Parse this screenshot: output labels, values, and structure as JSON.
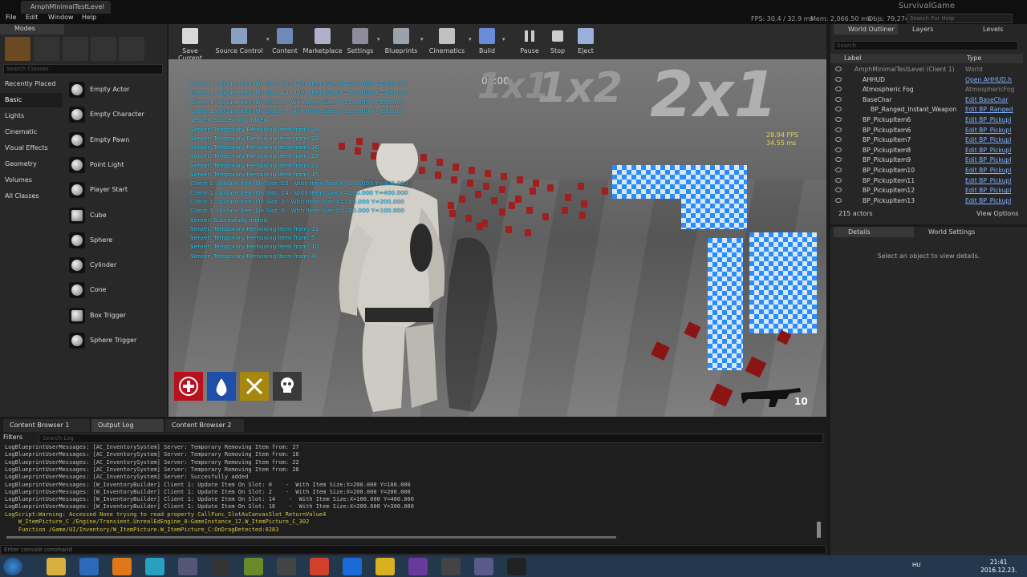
{
  "window": {
    "tab_title": "AmphMinimalTestLevel",
    "project": "SurvivalGame"
  },
  "menu": [
    "File",
    "Edit",
    "Window",
    "Help"
  ],
  "stats": {
    "fps": "FPS: 30.4 / 32.9 ms",
    "mem": "Mem: 2,066.50 mb",
    "objs": "Objs: 79,274",
    "help_placeholder": "Search For Help"
  },
  "modes": {
    "title": "Modes",
    "search_placeholder": "Search Classes",
    "categories": [
      "Recently Placed",
      "Basic",
      "Lights",
      "Cinematic",
      "Visual Effects",
      "Geometry",
      "Volumes",
      "All Classes"
    ],
    "classes": [
      "Empty Actor",
      "Empty Character",
      "Empty Pawn",
      "Point Light",
      "Player Start",
      "Cube",
      "Sphere",
      "Cylinder",
      "Cone",
      "Box Trigger",
      "Sphere Trigger"
    ]
  },
  "toolbar": {
    "buttons": [
      "Save Current",
      "Source Control",
      "Content",
      "Marketplace",
      "Settings",
      "Blueprints",
      "Cinematics",
      "Build",
      "Pause",
      "Stop",
      "Eject"
    ]
  },
  "viewport": {
    "messages": [
      "Client 1: Update Item On Slot: 16  -  With Item Size:X=200.000 Y=300.000",
      "Client 1: Update Item On Slot: 14  -  With Item Size:X=100.000 Y=400.000",
      "Client 1: Update Item On Slot: 2  -  With Item Size:X=200.000 Y=200.000",
      "Client 1: Update Item On Slot: 0  -  With Item Size:X=200.000 Y=100.000",
      "Server: Succesfully added",
      "Server: Temporary Removing Item from: 28",
      "Server: Temporary Removing Item from: 22",
      "Server: Temporary Removing Item from: 16",
      "Server: Temporary Removing Item from: 27",
      "Server: Temporary Removing Item from: 21",
      "Server: Temporary Removing Item from: 15",
      "Client 1: Update Item On Slot: 15  -  With Item Size:X=200.000 Y=300.000",
      "Client 1: Update Item On Slot: 14  -  With Item Size:X=100.000 Y=400.000",
      "Client 1: Update Item On Slot: 2  -  With Item Size:X=200.000 Y=200.000",
      "Client 1: Update Item On Slot: 0  -  With Item Size:X=200.000 Y=100.000",
      "Server: Succesfully added",
      "Server: Temporary Removing Item from: 11",
      "Server: Temporary Removing Item from: 5",
      "Server: Temporary Removing Item from: 10",
      "Server: Temporary Removing Item from: 4"
    ],
    "timer": "00:00",
    "sign1": "1x1",
    "sign2": "1x2",
    "sign3": "2x1",
    "fps": "28.94 FPS",
    "ms": "34.55 ms",
    "ammo": "10",
    "hotbar_icons": [
      "health-icon",
      "water-drop-icon",
      "food-icon",
      "skull-icon"
    ]
  },
  "bottom_tabs": [
    "Content Browser 1",
    "Output Log",
    "Content Browser 2"
  ],
  "log": {
    "filters": "Filters",
    "search_placeholder": "Search Log",
    "lines": [
      "LogBlueprintUserMessages: [AC_InventorySystem] Server: Temporary Removing Item from: 27",
      "LogBlueprintUserMessages: [AC_InventorySystem] Server: Temporary Removing Item from: 16",
      "LogBlueprintUserMessages: [AC_InventorySystem] Server: Temporary Removing Item from: 22",
      "LogBlueprintUserMessages: [AC_InventorySystem] Server: Temporary Removing Item from: 28",
      "LogBlueprintUserMessages: [AC_InventorySystem] Server: Succesfully added",
      "LogBlueprintUserMessages: [W_InventoryBuilder] Client 1: Update Item On Slot: 0    -  With Item Size:X=200.000 Y=100.000",
      "LogBlueprintUserMessages: [W_InventoryBuilder] Client 1: Update Item On Slot: 2    -  With Item Size:X=200.000 Y=200.000",
      "LogBlueprintUserMessages: [W_InventoryBuilder] Client 1: Update Item On Slot: 14    -  With Item Size:X=100.000 Y=400.000",
      "LogBlueprintUserMessages: [W_InventoryBuilder] Client 1: Update Item On Slot: 16    -  With Item Size:X=200.000 Y=300.000"
    ],
    "warn_lines": [
      "LogScript:Warning: Accessed None trying to read property CallFunc_SlotAsCanvasSlot_ReturnValue4",
      "    W_ItemPicture_C /Engine/Transient.UnrealEdEngine_0:GameInstance_17.W_ItemPicture_C_302",
      "    Function /Game/UI/Inventory/W_ItemPicture.W_ItemPicture_C:OnDragDetected:0283"
    ],
    "console_placeholder": "Enter console command"
  },
  "outliner": {
    "tabs": [
      "World Outliner",
      "Layers",
      "Levels"
    ],
    "search_placeholder": "Search",
    "col_label": "Label",
    "col_type": "Type",
    "rows": [
      {
        "name": "AmphMinimalTestLevel (Client 1)",
        "type": "World",
        "indent": 0,
        "link": false
      },
      {
        "name": "AHHUD",
        "type": "Open AHHUD.h",
        "indent": 1,
        "link": true
      },
      {
        "name": "Atmospheric Fog",
        "type": "AtmosphericFog",
        "indent": 1,
        "link": false
      },
      {
        "name": "BaseChar",
        "type": "Edit BaseChar",
        "indent": 1,
        "link": true
      },
      {
        "name": "BP_Ranged_Instant_Weapon",
        "type": "Edit BP_Ranged",
        "indent": 2,
        "link": true
      },
      {
        "name": "BP_PickupItem6",
        "type": "Edit BP_Pickupl",
        "indent": 1,
        "link": true
      },
      {
        "name": "BP_PickupItem6",
        "type": "Edit BP_Pickupl",
        "indent": 1,
        "link": true
      },
      {
        "name": "BP_PickupItem7",
        "type": "Edit BP_Pickupl",
        "indent": 1,
        "link": true
      },
      {
        "name": "BP_PickupItem8",
        "type": "Edit BP_Pickupl",
        "indent": 1,
        "link": true
      },
      {
        "name": "BP_PickupItem9",
        "type": "Edit BP_Pickupl",
        "indent": 1,
        "link": true
      },
      {
        "name": "BP_PickupItem10",
        "type": "Edit BP_Pickupl",
        "indent": 1,
        "link": true
      },
      {
        "name": "BP_PickupItem11",
        "type": "Edit BP_Pickupl",
        "indent": 1,
        "link": true
      },
      {
        "name": "BP_PickupItem12",
        "type": "Edit BP_Pickupl",
        "indent": 1,
        "link": true
      },
      {
        "name": "BP_PickupItem13",
        "type": "Edit BP_Pickupl",
        "indent": 1,
        "link": true
      }
    ],
    "actor_count": "215 actors",
    "view_options": "View Options"
  },
  "details": {
    "tabs": [
      "Details",
      "World Settings"
    ],
    "empty": "Select an object to view details."
  },
  "taskbar": {
    "lang": "HU",
    "time": "21:41",
    "date": "2016.12.23."
  },
  "colors": {
    "accent": "#2a8cff",
    "msg": "#2ec8ff",
    "warn": "#d7c43c",
    "fps": "#e6d44a"
  }
}
